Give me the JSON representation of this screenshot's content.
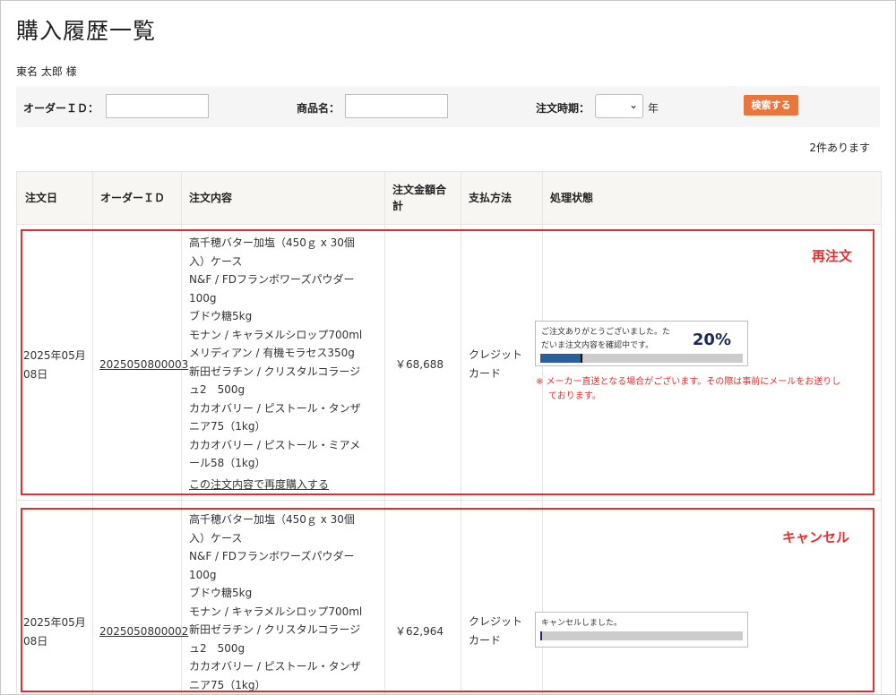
{
  "page": {
    "title": "購入履歴一覧",
    "user_name": "東名 太郎 様"
  },
  "search": {
    "order_id_label": "オーダーＩＤ：",
    "order_id_value": "",
    "product_label": "商品名：",
    "product_value": "",
    "period_label": "注文時期：",
    "period_value": "",
    "year_suffix": "年",
    "search_button": "検索する"
  },
  "result_count": "2件あります",
  "table": {
    "headers": [
      "注文日",
      "オーダーＩＤ",
      "注文内容",
      "注文金額合計",
      "支払方法",
      "処理状態"
    ],
    "rows": [
      {
        "date_line1": "2025年05月",
        "date_line2": "08日",
        "order_id": "2025050800003",
        "items": [
          "高千穂バター加塩（450ｇ x 30個",
          "入）ケース",
          "N&F / FDフランボワーズパウダー",
          "100g",
          "ブドウ糖5kg",
          "モナン / キャラメルシロップ700ml",
          "メリディアン / 有機モラセス350g",
          "新田ゼラチン / クリスタルコラージ",
          "ュ2　500g",
          "カカオバリー / ピストール・タンザ",
          "ニア75（1kg）",
          "カカオバリー / ピストール・ミアメ",
          "ール58（1kg）"
        ],
        "reorder_link": "この注文内容で再度購入する",
        "total": "￥68,688",
        "payment_line1": "クレジット",
        "payment_line2": "カード",
        "status_line1": "ご注文ありがとうございました。た",
        "status_line2": "だいま注文内容を確認中です。",
        "progress_percent": 20,
        "progress_label": "20%",
        "note_line1": "※ メーカー直送となる場合がございます。その際は事前にメールをお送りし",
        "note_line2": "ております。",
        "annotation": "再注文"
      },
      {
        "date_line1": "2025年05月",
        "date_line2": "08日",
        "order_id": "2025050800002",
        "items": [
          "高千穂バター加塩（450ｇ x 30個",
          "入）ケース",
          "N&F / FDフランボワーズパウダー",
          "100g",
          "ブドウ糖5kg",
          "モナン / キャラメルシロップ700ml",
          "新田ゼラチン / クリスタルコラージ",
          "ュ2　500g",
          "カカオバリー / ピストール・タンザ",
          "ニア75（1kg）"
        ],
        "total": "￥62,964",
        "payment_line1": "クレジット",
        "payment_line2": "カード",
        "status_line1": "キャンセルしました。",
        "progress_percent": 0,
        "annotation": "キャンセル"
      }
    ]
  },
  "colors": {
    "accent": "#e8773e",
    "annotation_red": "#e52d2d",
    "progress_fill": "#2c5f9e"
  }
}
